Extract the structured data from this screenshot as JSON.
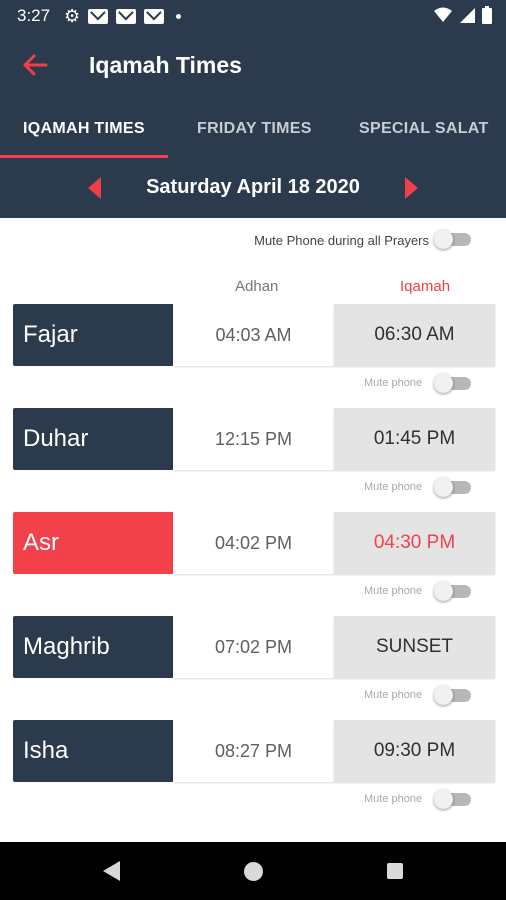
{
  "status_bar": {
    "time": "3:27",
    "icons": [
      "gear-icon",
      "gmail-icon",
      "gmail-icon",
      "gmail-icon",
      "dot-icon",
      "wifi-icon",
      "signal-icon",
      "battery-icon"
    ]
  },
  "app_bar": {
    "title": "Iqamah Times",
    "back_icon": "arrow-left-icon"
  },
  "tabs": [
    {
      "label": "IQAMAH TIMES",
      "active": true
    },
    {
      "label": "FRIDAY TIMES",
      "active": false
    },
    {
      "label": "SPECIAL SALAT",
      "active": false
    }
  ],
  "date_nav": {
    "date": "Saturday April 18 2020",
    "prev_icon": "caret-left-icon",
    "next_icon": "caret-right-icon"
  },
  "mute_all": {
    "label": "Mute Phone during all Prayers",
    "enabled": false
  },
  "columns": {
    "adhan": "Adhan",
    "iqamah": "Iqamah"
  },
  "prayers": [
    {
      "name": "Fajar",
      "adhan": "04:03 AM",
      "iqamah": "06:30 AM",
      "mute_label": "Mute phone",
      "mute": false,
      "current": false
    },
    {
      "name": "Duhar",
      "adhan": "12:15 PM",
      "iqamah": "01:45 PM",
      "mute_label": "Mute phone",
      "mute": false,
      "current": false
    },
    {
      "name": "Asr",
      "adhan": "04:02 PM",
      "iqamah": "04:30 PM",
      "mute_label": "Mute phone",
      "mute": false,
      "current": true
    },
    {
      "name": "Maghrib",
      "adhan": "07:02 PM",
      "iqamah": "SUNSET",
      "mute_label": "Mute phone",
      "mute": false,
      "current": false
    },
    {
      "name": "Isha",
      "adhan": "08:27 PM",
      "iqamah": "09:30 PM",
      "mute_label": "Mute phone",
      "mute": false,
      "current": false
    }
  ],
  "colors": {
    "primary": "#2b3a4d",
    "accent": "#ef3f48",
    "iqamah_cell": "#e4e4e4"
  },
  "nav_bar": {
    "icons": [
      "back-triangle-icon",
      "home-circle-icon",
      "recents-square-icon"
    ]
  }
}
